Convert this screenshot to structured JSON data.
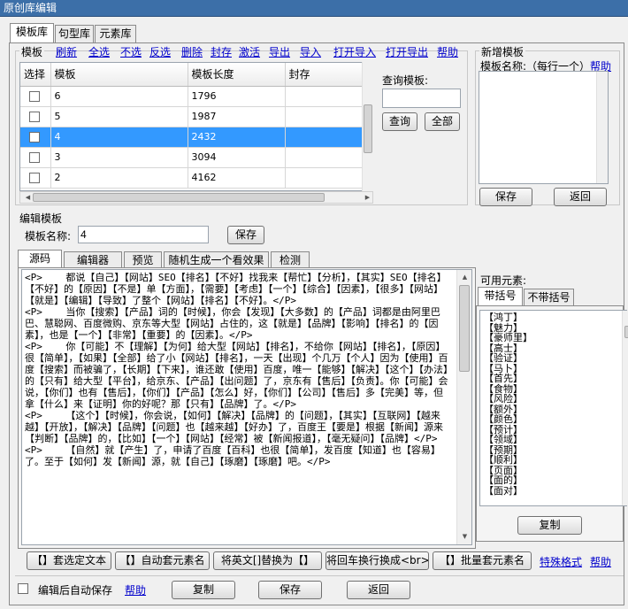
{
  "window": {
    "title": "原创库编辑"
  },
  "main_tabs": [
    "模板库",
    "句型库",
    "元素库"
  ],
  "template_panel": {
    "label": "模板",
    "toolbar": [
      "刷新",
      "全选",
      "不选",
      "反选",
      "删除",
      "封存",
      "激活",
      "导出",
      "导入",
      "打开导入",
      "打开导出",
      "帮助"
    ],
    "columns": [
      "选择",
      "模板",
      "模板长度",
      "封存"
    ],
    "rows": [
      {
        "name": "6",
        "length": "1796",
        "sealed": "",
        "selected": false
      },
      {
        "name": "5",
        "length": "1987",
        "sealed": "",
        "selected": false
      },
      {
        "name": "4",
        "length": "2432",
        "sealed": "",
        "selected": true
      },
      {
        "name": "3",
        "length": "3094",
        "sealed": "",
        "selected": false
      },
      {
        "name": "2",
        "length": "4162",
        "sealed": "",
        "selected": false
      }
    ],
    "query_label": "查询模板:",
    "query_value": "",
    "query_button": "查询",
    "all_button": "全部"
  },
  "new_template": {
    "label": "新增模板",
    "name_label": "模板名称:（每行一个）",
    "help": "帮助",
    "value": "",
    "save": "保存",
    "back": "返回"
  },
  "edit_template": {
    "label": "编辑模板",
    "name_label": "模板名称:",
    "name_value": "4",
    "save": "保存"
  },
  "edit_tabs": [
    "源码",
    "编辑器",
    "预览",
    "随机生成一个看效果",
    "检测"
  ],
  "source_text": "<P>    都说【自己】【网站】SEO【排名】【不好】找我来【帮忙】【分析】，【其实】SEO【排名】【不好】的【原因】【不是】单【方面】，【需要】【考虑】【一个】【综合】【因素】，【很多】【网站】【就是】【编辑】【导致】了整个【网站】【排名】【不好】。</P>\n<P>    当你【搜索】【产品】词的【时候】，你会【发现】【大多数】的【产品】词都是由阿里巴巴、慧聪网、百度微购、京东等大型【网站】占住的，这【就是】【品牌】【影响】【排名】的【因素】，也是【一个】【非常】【重要】的【因素】。</P>\n<P>    你【可能】不【理解】【为何】给大型【网站】【排名】，不给你【网站】【排名】，【原因】很【简单】，【如果】【全部】给了小【网站】【排名】，一天【出现】个几万【个人】因为【使用】百度【搜索】而被骗了，【长期】【下来】，谁还敢【使用】百度，唯一【能够】【解决】【这个】【办法】的【只有】给大型【平台】，给京东、【产品】【出问题】了，京东有【售后】【负责】。你【可能】会说，【你们】也有【售后】，【你们】【产品】【怎么】好，【你们】【公司】【售后】多【完美】等，但拿【什么】来【证明】你的好呢？那【只有】【品牌】了。</P>\n<P>    【这个】【时候】，你会说，【如何】【解决】【品牌】的【问题】，【其实】【互联网】【越来越】【开放】，【解决】【品牌】【问题】也【越来越】【好办】了，百度王【要是】根据【新闻】源来【判断】【品牌】的，【比如】【一个】【网站】【经常】被【新闻报道】，【毫无疑问】【品牌】</P>\n<P>    【自然】就【产生】了，申请了百度【百科】也很【简单】，发百度【知道】也【容易】了。至于【如何】发【新闻】源，就【自己】【琢磨】【琢磨】吧。</P>",
  "elements": {
    "label": "可用元素:",
    "tabs": [
      "带括号",
      "不带括号"
    ],
    "items": [
      "【鸿丁】",
      "【魅力】",
      "【豪师里】",
      "【高士】",
      "【验证】",
      "【马卜】",
      "【首先】",
      "【食物】",
      "【风险】",
      "【额外】",
      "【颜色】",
      "【预计】",
      "【领域】",
      "【预期】",
      "【顺利】",
      "【页面】",
      "【面的】",
      "【面对】"
    ],
    "copy": "复制"
  },
  "bottom_buttons": [
    "【】套选定文本",
    "【】自动套元素名",
    "将英文[]替换为【】",
    "将回车换行换成<br>",
    "【】批量套元素名"
  ],
  "special_format": "特殊格式",
  "help2": "帮助",
  "footer": {
    "auto_save_label": "编辑后自动保存",
    "help": "帮助",
    "copy": "复制",
    "save": "保存",
    "back": "返回"
  }
}
